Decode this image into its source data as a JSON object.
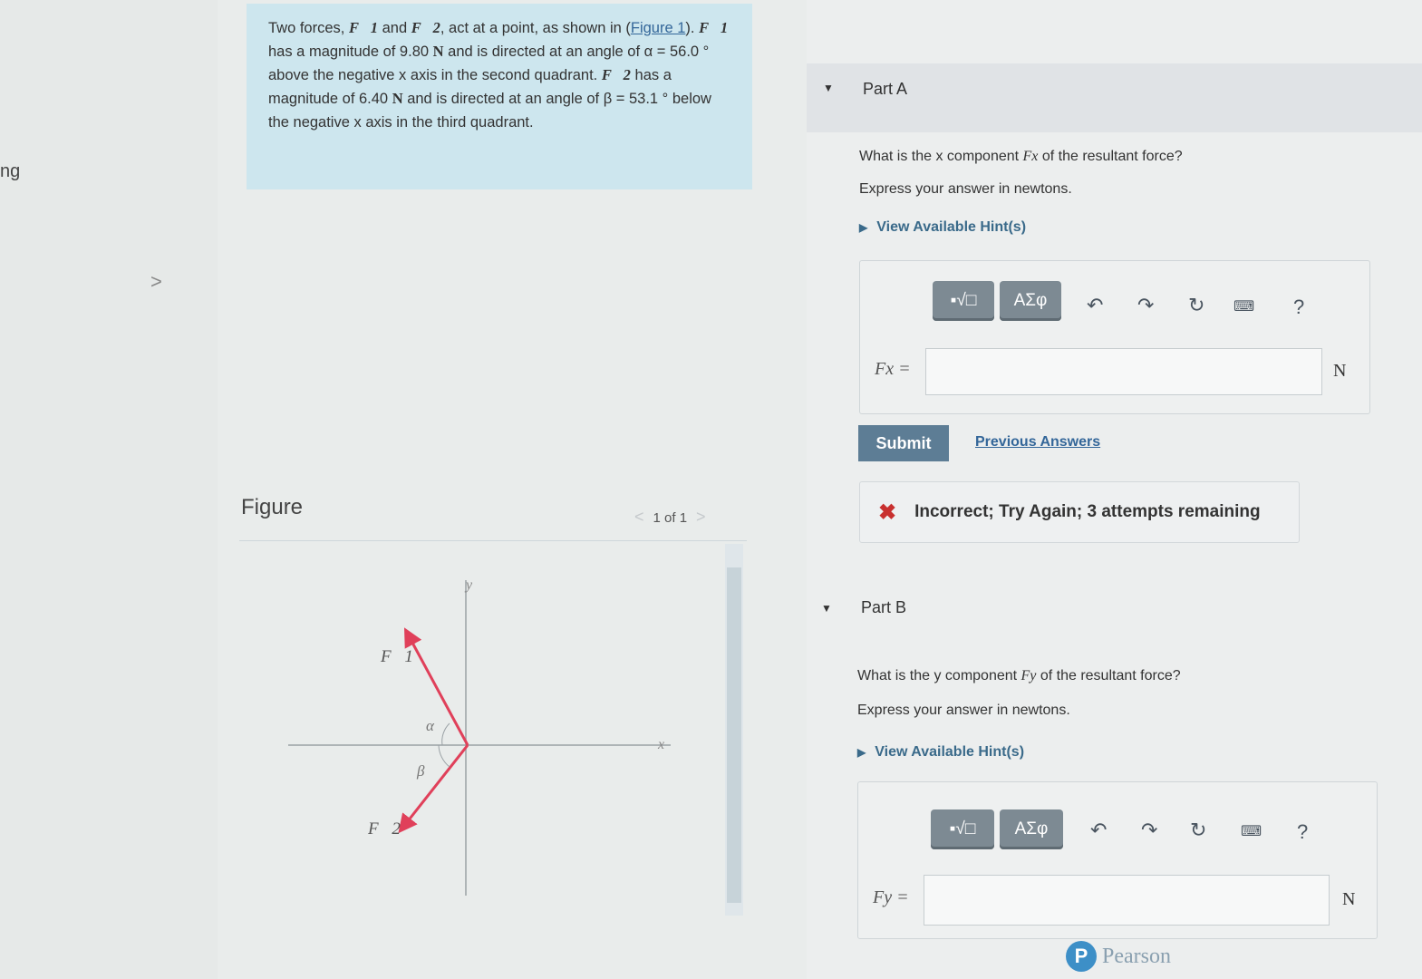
{
  "left_gutter": {
    "text": "ng",
    "arrow": ">"
  },
  "problem": {
    "t1": "Two forces, ",
    "f1": "F⃗1",
    "t2": " and ",
    "f2": "F⃗2",
    "t3": ", act at a point, as shown in (",
    "figure_link": "Figure 1",
    "t4": "). ",
    "f1b": "F⃗1",
    "t5": " has a magnitude of 9.80 ",
    "unit_n1": "N",
    "t6": " and is directed at an angle of ",
    "alpha_expr": "α = 56.0 °",
    "t7": " above the negative x axis in the second quadrant. ",
    "f2b": "F⃗2",
    "t8": " has a magnitude of 6.40 ",
    "unit_n2": "N",
    "t9": " and is directed at an angle of ",
    "beta_expr": "β = 53.1 °",
    "t10": " below the negative x axis in the third quadrant."
  },
  "figure": {
    "label": "Figure",
    "pager": "1 of 1",
    "prev": "<",
    "next": ">",
    "labels": {
      "y": "y",
      "x": "x",
      "F1": "F⃗1",
      "F2": "F⃗2",
      "alpha": "α",
      "beta": "β"
    }
  },
  "partA": {
    "title": "Part A",
    "q_pre": "What is the x component ",
    "q_var": "Fx",
    "q_post": " of the resultant force?",
    "express": "Express your answer in newtons.",
    "hint": "View Available Hint(s)",
    "tb_math": "▪√□",
    "tb_greek": "ΑΣφ",
    "help": "?",
    "var_label": "Fx =",
    "unit": "N",
    "input_value": "",
    "submit": "Submit",
    "previous_answers": "Previous Answers",
    "feedback": "Incorrect; Try Again; 3 attempts remaining"
  },
  "partB": {
    "title": "Part B",
    "q_pre": "What is the y component ",
    "q_var": "Fy",
    "q_post": " of the resultant force?",
    "express": "Express your answer in newtons.",
    "hint": "View Available Hint(s)",
    "tb_math": "▪√□",
    "tb_greek": "ΑΣφ",
    "help": "?",
    "var_label": "Fy =",
    "unit": "N",
    "input_value": ""
  },
  "footer": {
    "brand": "Pearson",
    "logo_letter": "P"
  },
  "icons": {
    "undo": "undo-icon",
    "redo": "redo-icon",
    "reset": "reset-icon",
    "keyboard": "keyboard-icon",
    "incorrect": "x-mark-icon",
    "triangle": "collapse-triangle-icon"
  },
  "colors": {
    "problem_bg": "#cde6ee",
    "submit_bg": "#5d7d95",
    "incorrect": "#c8302f",
    "link": "#336699",
    "toolbar_btn": "#7d8a93",
    "force_arrow": "#e0405a"
  }
}
